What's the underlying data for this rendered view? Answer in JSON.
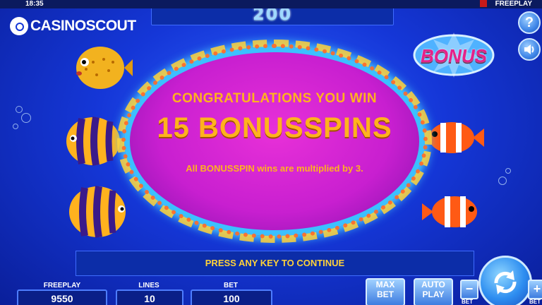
{
  "status_bar": {
    "time": "18:35",
    "mode": "FREEPLAY"
  },
  "win_display": {
    "value": "200"
  },
  "brand": {
    "name": "CASINOSCOUT"
  },
  "help_button": {
    "label": "?"
  },
  "sound_button": {
    "icon": "speaker-icon"
  },
  "bonus_symbol": {
    "label": "BONUS"
  },
  "popup": {
    "title": "CONGRATULATIONS YOU WIN",
    "headline": "15 BONUSSPINS",
    "note": "All BONUSSPIN wins are multiplied by 3."
  },
  "prompt": {
    "text": "PRESS ANY KEY TO CONTINUE"
  },
  "footer": {
    "freeplay_label": "FREEPLAY",
    "freeplay_value": "9550",
    "lines_label": "LINES",
    "lines_value": "10",
    "bet_label": "BET",
    "bet_value": "100"
  },
  "controls": {
    "max_bet_line1": "MAX",
    "max_bet_line2": "BET",
    "auto_play_line1": "AUTO",
    "auto_play_line2": "PLAY",
    "minus": "−",
    "plus": "+",
    "bet_small_left": "BET",
    "bet_small_right": "BET"
  },
  "colors": {
    "background": "#1537d8",
    "popup": "#c81fd0",
    "gold_text": "#ffb21e",
    "frame_glow": "#3cc0ff"
  }
}
